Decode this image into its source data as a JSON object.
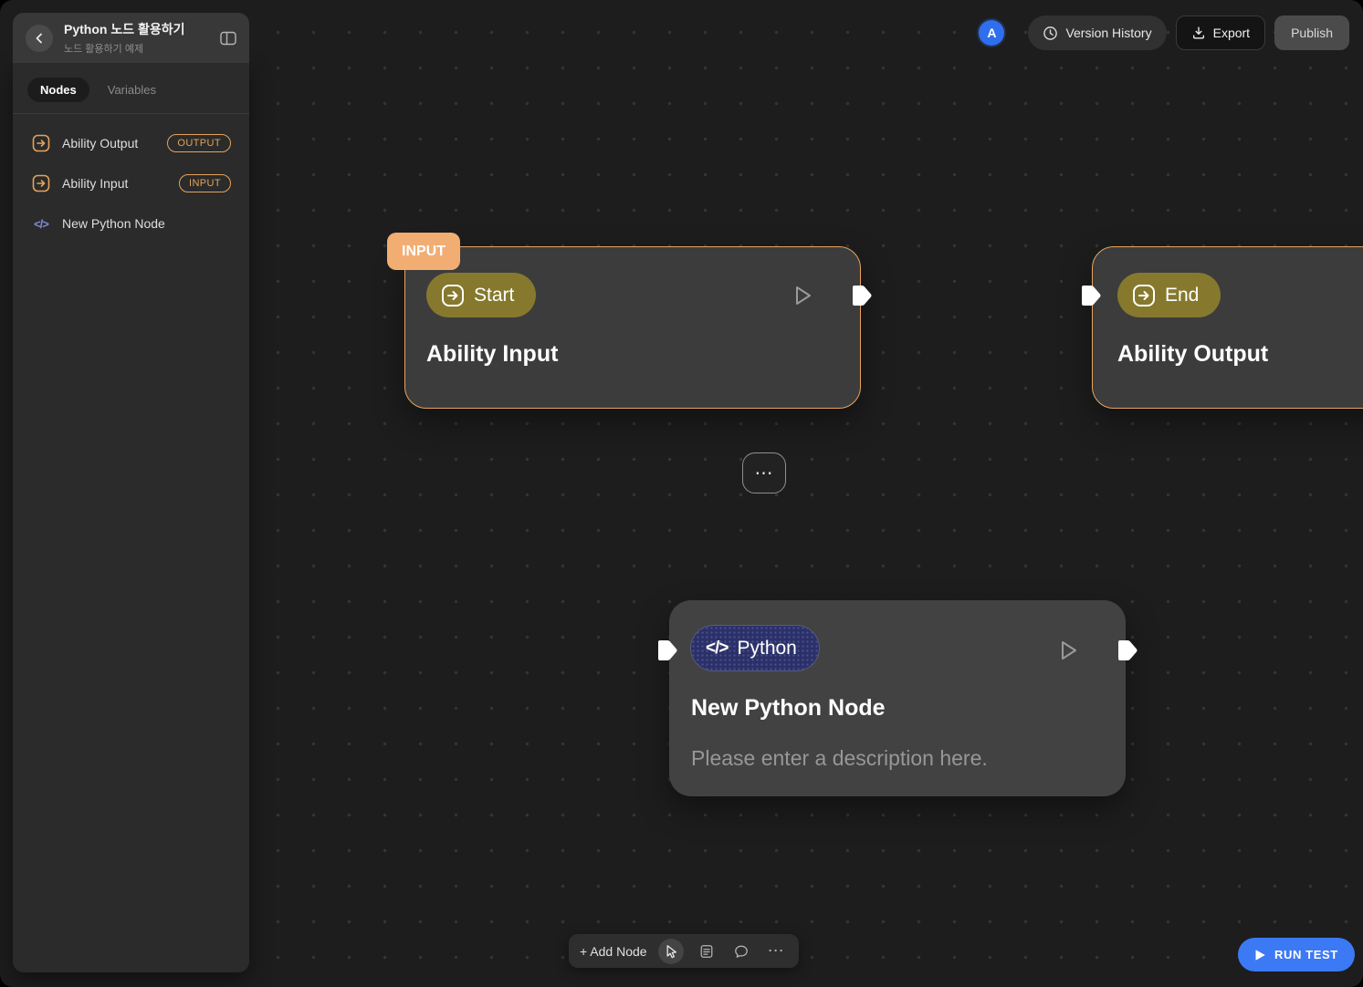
{
  "header": {
    "title": "Python 노드 활용하기",
    "subtitle": "노드 활용하기 예제"
  },
  "topbar": {
    "avatar_initial": "A",
    "version_history_label": "Version History",
    "export_label": "Export",
    "publish_label": "Publish"
  },
  "sidebar": {
    "tabs": {
      "nodes": "Nodes",
      "variables": "Variables"
    },
    "items": [
      {
        "label": "Ability Output",
        "badge": "OUTPUT"
      },
      {
        "label": "Ability Input",
        "badge": "INPUT"
      },
      {
        "label": "New Python Node",
        "badge": "",
        "icon_glyph": "</>"
      }
    ]
  },
  "nodes": {
    "input": {
      "tag": "INPUT",
      "pill": "Start",
      "title": "Ability Input"
    },
    "output": {
      "pill": "End",
      "title": "Ability Output"
    },
    "python": {
      "pill": "Python",
      "icon_glyph": "</>",
      "title": "New Python Node",
      "description": "Please enter a description here."
    }
  },
  "canvas": {
    "wire_button_glyph": "⋯"
  },
  "toolbar": {
    "add_node_label": "+ Add Node",
    "more_glyph": "⋯"
  },
  "actions": {
    "run_test_label": "RUN TEST"
  },
  "colors": {
    "accent_orange": "#E8A35F",
    "tag_orange": "#F2AD73",
    "olive_pill": "#86792E",
    "python_navy": "#2B3168",
    "primary_blue": "#3C79F5"
  }
}
